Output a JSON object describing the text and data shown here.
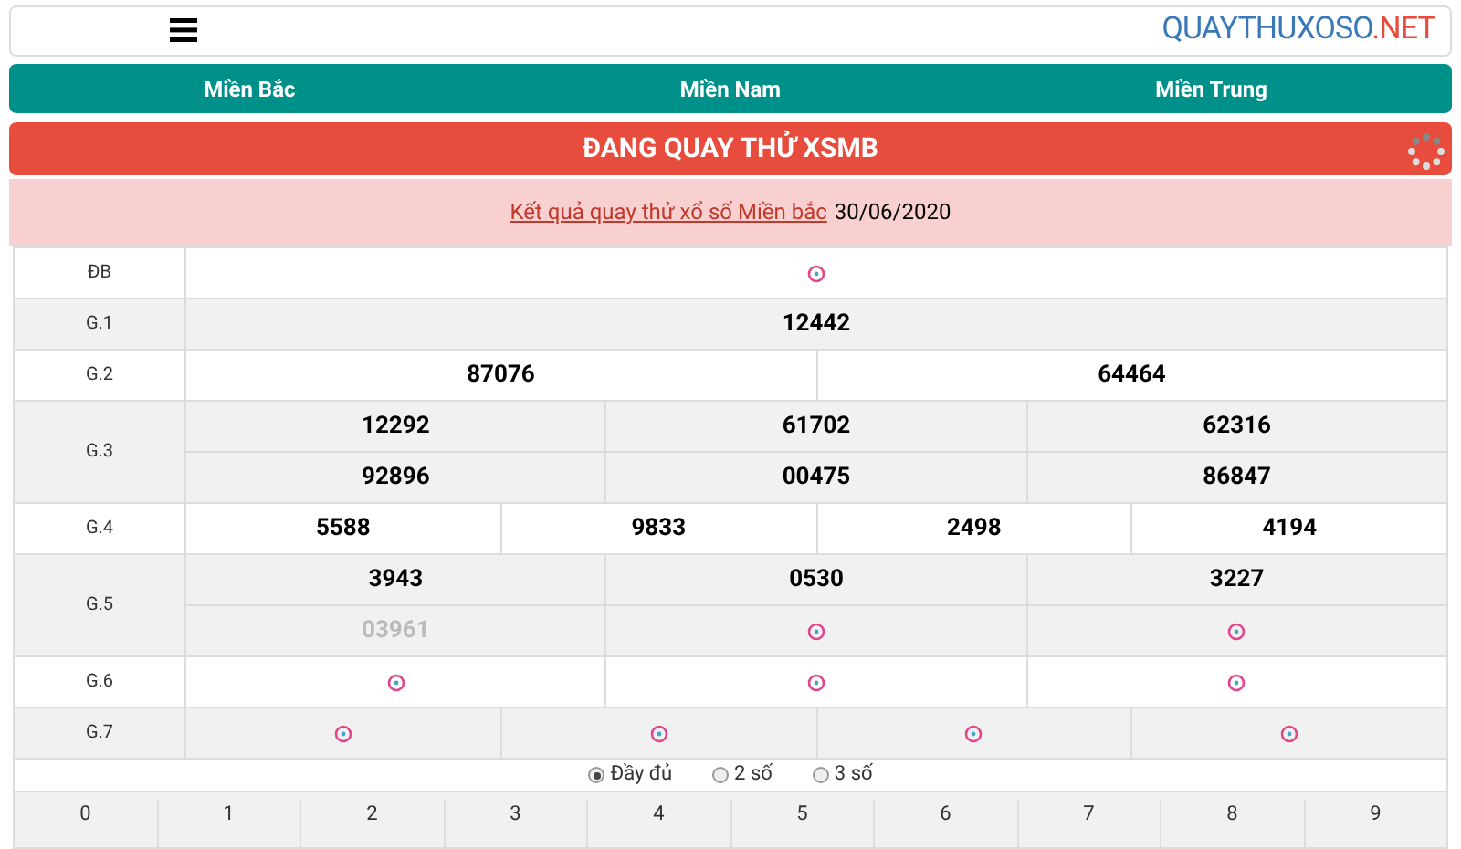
{
  "header": {
    "logo_main": "QUAYTHUXOSO",
    "logo_suffix": ".NET"
  },
  "regions": [
    {
      "label": "Miền Bắc"
    },
    {
      "label": "Miền Nam"
    },
    {
      "label": "Miền Trung"
    }
  ],
  "banner": {
    "title": "ĐANG QUAY THỬ XSMB"
  },
  "result_heading": {
    "link": "Kết quả quay thử xổ số Miền bắc",
    "date": "30/06/2020"
  },
  "prizes": [
    {
      "label": "ĐB",
      "lines": [
        [
          {
            "kind": "spinner"
          }
        ]
      ]
    },
    {
      "label": "G.1",
      "lines": [
        [
          {
            "kind": "number",
            "value": "12442"
          }
        ]
      ]
    },
    {
      "label": "G.2",
      "lines": [
        [
          {
            "kind": "number",
            "value": "87076"
          },
          {
            "kind": "number",
            "value": "64464"
          }
        ]
      ]
    },
    {
      "label": "G.3",
      "lines": [
        [
          {
            "kind": "number",
            "value": "12292"
          },
          {
            "kind": "number",
            "value": "61702"
          },
          {
            "kind": "number",
            "value": "62316"
          }
        ],
        [
          {
            "kind": "number",
            "value": "92896"
          },
          {
            "kind": "number",
            "value": "00475"
          },
          {
            "kind": "number",
            "value": "86847"
          }
        ]
      ]
    },
    {
      "label": "G.4",
      "lines": [
        [
          {
            "kind": "number",
            "value": "5588"
          },
          {
            "kind": "number",
            "value": "9833"
          },
          {
            "kind": "number",
            "value": "2498"
          },
          {
            "kind": "number",
            "value": "4194"
          }
        ]
      ]
    },
    {
      "label": "G.5",
      "lines": [
        [
          {
            "kind": "number",
            "value": "3943"
          },
          {
            "kind": "number",
            "value": "0530"
          },
          {
            "kind": "number",
            "value": "3227"
          }
        ],
        [
          {
            "kind": "rolling",
            "value": "03961"
          },
          {
            "kind": "spinner"
          },
          {
            "kind": "spinner"
          }
        ]
      ]
    },
    {
      "label": "G.6",
      "lines": [
        [
          {
            "kind": "spinner"
          },
          {
            "kind": "spinner"
          },
          {
            "kind": "spinner"
          }
        ]
      ]
    },
    {
      "label": "G.7",
      "lines": [
        [
          {
            "kind": "spinner"
          },
          {
            "kind": "spinner"
          },
          {
            "kind": "spinner"
          },
          {
            "kind": "spinner"
          }
        ]
      ]
    }
  ],
  "display_options": [
    {
      "label": "Đầy đủ",
      "selected": true
    },
    {
      "label": "2 số",
      "selected": false
    },
    {
      "label": "3 số",
      "selected": false
    }
  ],
  "digit_columns": [
    "0",
    "1",
    "2",
    "3",
    "4",
    "5",
    "6",
    "7",
    "8",
    "9"
  ]
}
